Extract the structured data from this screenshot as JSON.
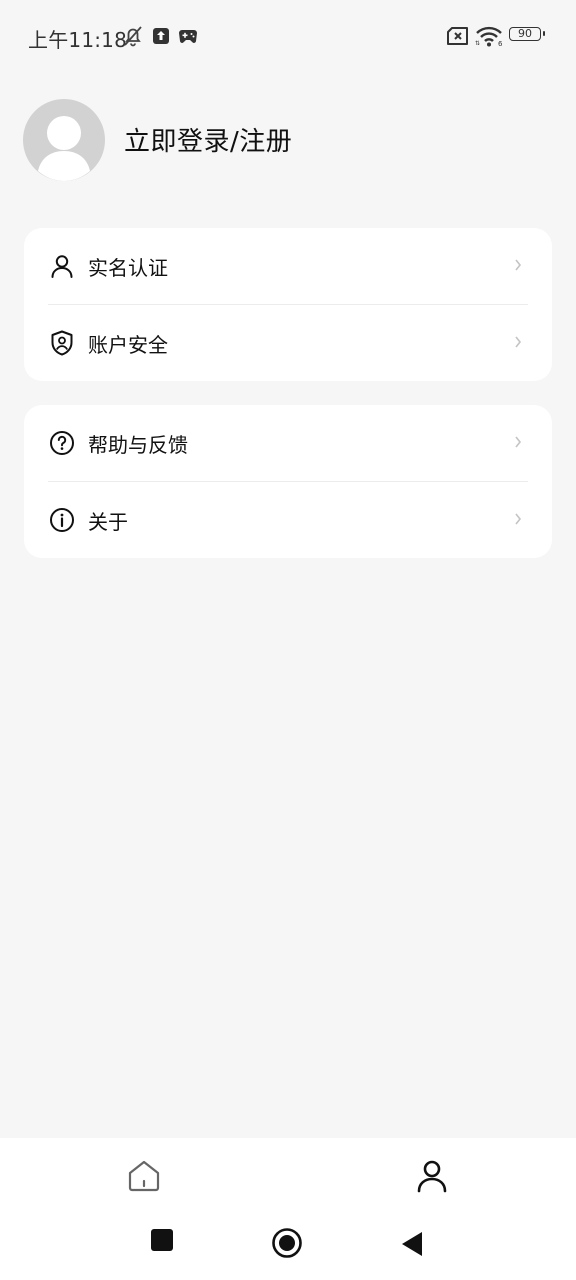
{
  "status_bar": {
    "time": "上午11:18",
    "battery": "90",
    "icons": [
      "mute-bell-icon",
      "upload-icon",
      "gamepad-icon",
      "sim-x-icon",
      "wifi-icon",
      "battery-icon"
    ]
  },
  "profile": {
    "login_label": "立即登录/注册"
  },
  "menu": {
    "group1": [
      {
        "label": "实名认证",
        "icon": "user-icon"
      },
      {
        "label": "账户安全",
        "icon": "shield-user-icon"
      }
    ],
    "group2": [
      {
        "label": "帮助与反馈",
        "icon": "question-circle-icon"
      },
      {
        "label": "关于",
        "icon": "info-circle-icon"
      }
    ]
  },
  "bottom_tabs": [
    {
      "name": "home",
      "icon": "home-icon",
      "active": false
    },
    {
      "name": "profile",
      "icon": "user-icon",
      "active": true
    }
  ],
  "colors": {
    "background": "#f6f6f6",
    "card": "#ffffff",
    "avatar": "#d2d2d2",
    "text": "#111111",
    "chevron": "#c4c4c4"
  }
}
